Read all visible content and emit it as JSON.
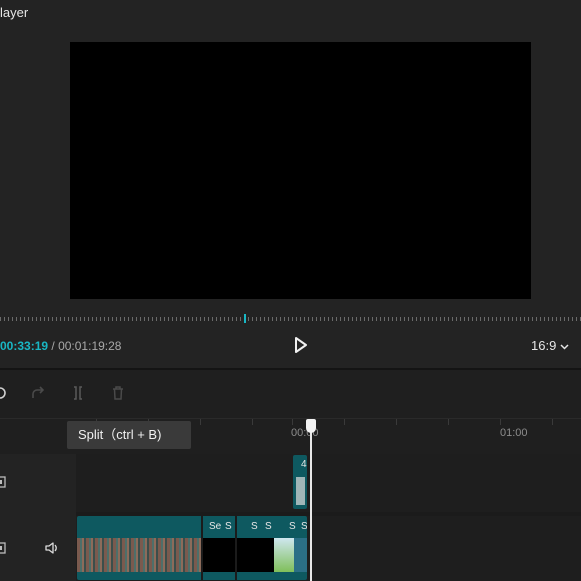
{
  "panel": {
    "title": "layer"
  },
  "player": {
    "current_time": "00:33:19",
    "separator": "/",
    "total_time": "00:01:19:28",
    "aspect_ratio": "16:9",
    "progress_fraction": 0.42
  },
  "toolbar": {
    "undo_icon": "undo-icon",
    "redo_icon": "redo-icon",
    "split_icon": "split-icon",
    "delete_icon": "trash-icon"
  },
  "tooltip": {
    "split": "Split（ctrl + B)"
  },
  "ruler": {
    "labels": [
      "00:00",
      "01:00"
    ]
  },
  "tracks": {
    "overlay": {
      "clip_label": "4"
    },
    "main": {
      "clip_labels": [
        "Sе",
        "S",
        "S",
        "S",
        "S",
        "S"
      ]
    }
  },
  "colors": {
    "accent": "#19b7c4",
    "clip": "#0e5960",
    "background": "#1f1f1f"
  }
}
